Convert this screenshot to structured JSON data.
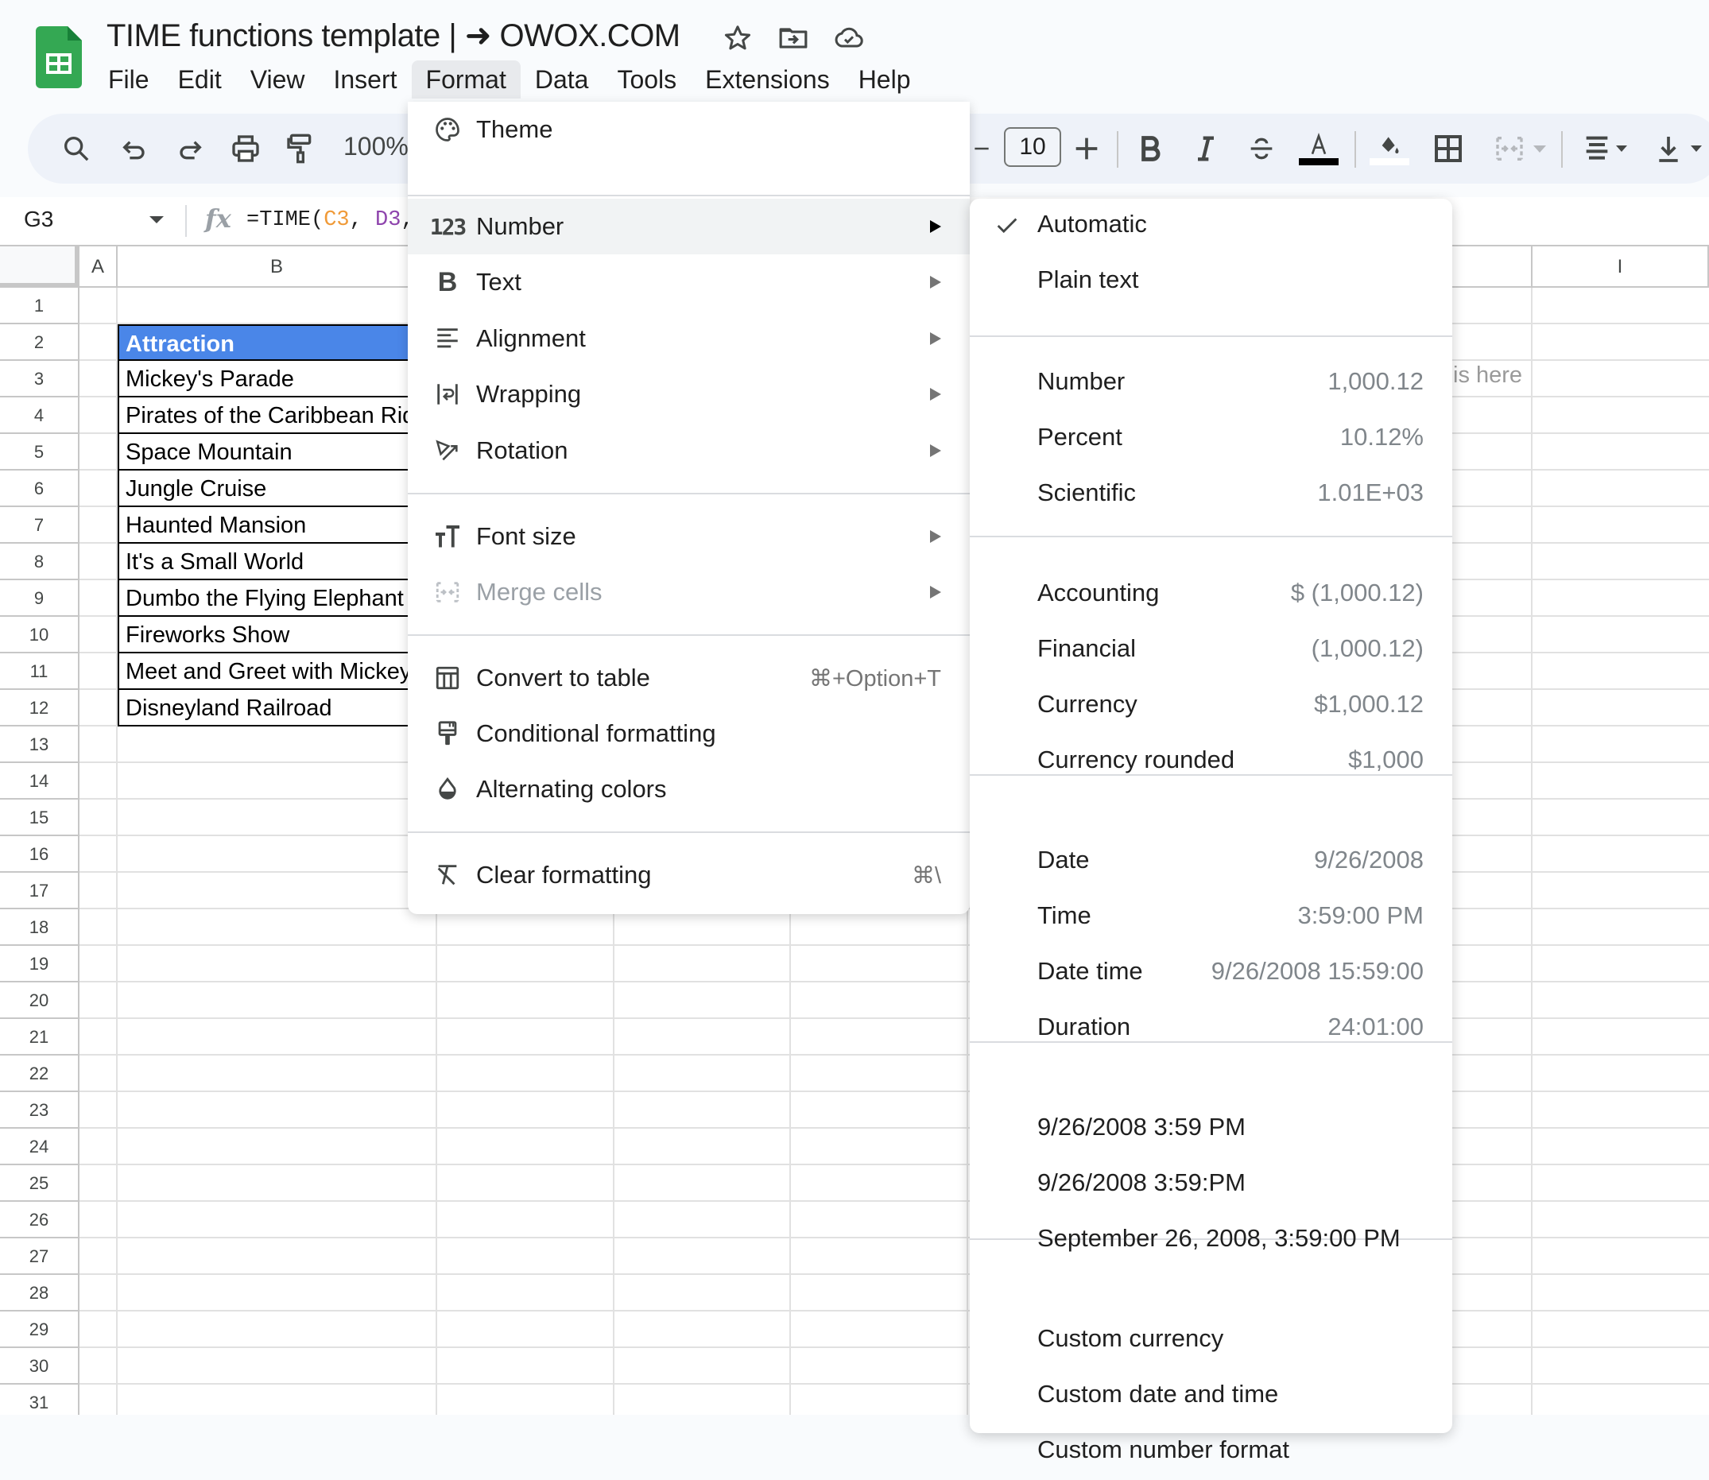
{
  "app": {
    "title": "TIME functions template | ➜ OWOX.COM",
    "header_icons": [
      "star-icon",
      "move-to-folder-icon",
      "cloud-saved-icon"
    ]
  },
  "menubar": {
    "items": [
      {
        "label": "File"
      },
      {
        "label": "Edit"
      },
      {
        "label": "View"
      },
      {
        "label": "Insert"
      },
      {
        "label": "Format",
        "active": true
      },
      {
        "label": "Data"
      },
      {
        "label": "Tools"
      },
      {
        "label": "Extensions"
      },
      {
        "label": "Help"
      }
    ]
  },
  "toolbar": {
    "zoom": "100%",
    "font_size": "10",
    "icons": [
      "search-icon",
      "undo-icon",
      "redo-icon",
      "print-icon",
      "paint-format-icon",
      "decrease-font-size-icon",
      "increase-font-size-icon",
      "bold-icon",
      "italic-icon",
      "strikethrough-icon",
      "text-color-icon",
      "fill-color-icon",
      "borders-icon",
      "merge-cells-icon",
      "horizontal-align-icon",
      "vertical-align-icon"
    ],
    "text_color": "#000000",
    "fill_color": "#ffffff"
  },
  "formula_bar": {
    "name_box": "G3",
    "fx_label": "fx",
    "formula_prefix": "=TIME(",
    "ref1": "C3",
    "sep1": ", ",
    "ref2": "D3",
    "suffix": ",",
    "ref1_color": "#f09a38",
    "ref2_color": "#8e44ad"
  },
  "sheet": {
    "columns": [
      {
        "label": "A"
      },
      {
        "label": "B"
      },
      {
        "label": "I"
      }
    ],
    "row_numbers": [
      "1",
      "2",
      "3",
      "4",
      "5",
      "6",
      "7",
      "8",
      "9",
      "10",
      "11",
      "12",
      "13",
      "14",
      "15",
      "16",
      "17",
      "18",
      "19",
      "20",
      "21",
      "22",
      "23",
      "24",
      "25",
      "26",
      "27",
      "28",
      "29",
      "30",
      "31"
    ],
    "header_cell": "Attraction",
    "header_color": "#4a86e8",
    "attractions": [
      "Mickey's Parade",
      "Pirates of the Caribbean Ride",
      "Space Mountain",
      "Jungle Cruise",
      "Haunted Mansion",
      "It's a Small World",
      "Dumbo the Flying Elephant",
      "Fireworks Show",
      "Meet and Greet with Mickey",
      "Disneyland Railroad"
    ],
    "h3_partial_text": "is here"
  },
  "format_menu": {
    "items": [
      {
        "label": "Theme",
        "icon": "palette-icon"
      },
      {
        "label": "Number",
        "icon": "number-123-icon",
        "submenu": true,
        "highlighted": true
      },
      {
        "label": "Text",
        "icon": "bold-b-icon",
        "submenu": true
      },
      {
        "label": "Alignment",
        "icon": "align-left-icon",
        "submenu": true
      },
      {
        "label": "Wrapping",
        "icon": "text-wrap-icon",
        "submenu": true
      },
      {
        "label": "Rotation",
        "icon": "text-rotation-icon",
        "submenu": true
      },
      {
        "label": "Font size",
        "icon": "font-size-icon",
        "submenu": true
      },
      {
        "label": "Merge cells",
        "icon": "merge-cells-icon",
        "submenu": true,
        "disabled": true
      },
      {
        "label": "Convert to table",
        "icon": "table-icon",
        "shortcut": "⌘+Option+T"
      },
      {
        "label": "Conditional formatting",
        "icon": "paint-roller-icon"
      },
      {
        "label": "Alternating colors",
        "icon": "color-drop-icon"
      },
      {
        "label": "Clear formatting",
        "icon": "clear-format-icon",
        "shortcut": "⌘\\"
      }
    ]
  },
  "number_submenu": {
    "items": [
      {
        "label": "Automatic",
        "checked": true
      },
      {
        "label": "Plain text"
      },
      {
        "label": "Number",
        "example": "1,000.12"
      },
      {
        "label": "Percent",
        "example": "10.12%"
      },
      {
        "label": "Scientific",
        "example": "1.01E+03"
      },
      {
        "label": "Accounting",
        "example": "$ (1,000.12)"
      },
      {
        "label": "Financial",
        "example": "(1,000.12)"
      },
      {
        "label": "Currency",
        "example": "$1,000.12"
      },
      {
        "label": "Currency rounded",
        "example": "$1,000"
      },
      {
        "label": "Date",
        "example": "9/26/2008"
      },
      {
        "label": "Time",
        "example": "3:59:00 PM"
      },
      {
        "label": "Date time",
        "example": "9/26/2008 15:59:00"
      },
      {
        "label": "Duration",
        "example": "24:01:00"
      },
      {
        "label": "9/26/2008 3:59 PM"
      },
      {
        "label": "9/26/2008 3:59:PM"
      },
      {
        "label": "September 26, 2008, 3:59:00 PM"
      },
      {
        "label": "Custom currency"
      },
      {
        "label": "Custom date and time"
      },
      {
        "label": "Custom number format"
      }
    ]
  }
}
